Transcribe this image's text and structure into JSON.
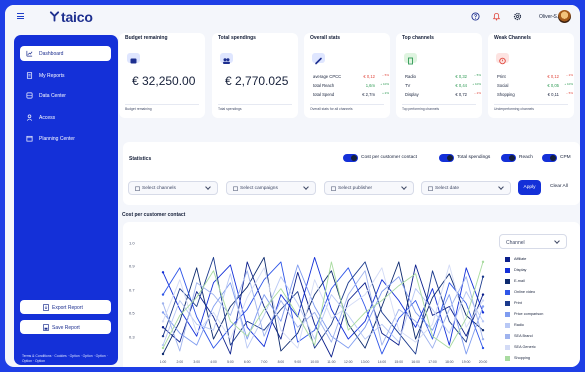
{
  "app": {
    "logo": "taico",
    "user_name": "Oliver S."
  },
  "sidebar": {
    "items": [
      {
        "label": "Dashboard",
        "icon": "dashboard-icon",
        "active": true
      },
      {
        "label": "My Reports",
        "icon": "reports-icon",
        "active": false
      },
      {
        "label": "Data Center",
        "icon": "data-center-icon",
        "active": false
      },
      {
        "label": "Access",
        "icon": "access-icon",
        "active": false
      },
      {
        "label": "Planning Center",
        "icon": "calendar-icon",
        "active": false
      }
    ],
    "export_label": "Export Report",
    "save_label": "Save Report",
    "footer": "Terms & Conditions · Cookies · Option · Option · Option · Option · Option"
  },
  "cards": {
    "budget": {
      "title": "Budget remaining",
      "value": "€ 32,250.00",
      "footer": "Budget remaining",
      "badge_color": "#dfe6ff"
    },
    "spendings": {
      "title": "Total spendings",
      "value": "€ 2,770.025",
      "footer": "Total spendings",
      "badge_color": "#dfe6ff"
    },
    "overall": {
      "title": "Overall stats",
      "footer": "Overall stats for all channels",
      "rows": [
        {
          "label": "average CPCC",
          "value": "€ 0,12",
          "change": "− 5%",
          "trend": "neg"
        },
        {
          "label": "total Reach",
          "value": "1,6m",
          "change": "+ 10%",
          "trend": "pos"
        },
        {
          "label": "total Spend",
          "value": "€ 2,7m",
          "change": "+ 2%",
          "trend": "pos"
        }
      ]
    },
    "top_channels": {
      "title": "Top channels",
      "footer": "Top performing channels",
      "rows": [
        {
          "label": "Radio",
          "value": "€ 0,32",
          "change": "− 5%",
          "trend": "pos"
        },
        {
          "label": "TV",
          "value": "€ 0,44",
          "change": "+ 10%",
          "trend": "pos"
        },
        {
          "label": "Display",
          "value": "€ 0,72",
          "change": "− 2%",
          "trend": "neutral"
        }
      ]
    },
    "weak_channels": {
      "title": "Weak Channels",
      "footer": "Underperforming channels",
      "rows": [
        {
          "label": "Print",
          "value": "€ 0,12",
          "change": "− 2%",
          "trend": "neg"
        },
        {
          "label": "Social",
          "value": "€ 0,05",
          "change": "+ 10%",
          "trend": "pos"
        },
        {
          "label": "Shopping",
          "value": "€ 0,11",
          "change": "− 5%",
          "trend": "neutral"
        }
      ]
    }
  },
  "statistics": {
    "title": "Statistics",
    "toggles": [
      {
        "label": "Cost per customer contact",
        "on": true
      },
      {
        "label": "Total spendings",
        "on": true
      },
      {
        "label": "Reach",
        "on": true
      },
      {
        "label": "CPM",
        "on": true
      }
    ],
    "filters": [
      {
        "placeholder": "Select channels",
        "icon": "calendar-icon"
      },
      {
        "placeholder": "Select campaigns",
        "icon": "calendar-icon"
      },
      {
        "placeholder": "Select publisher",
        "icon": "calendar-icon"
      },
      {
        "placeholder": "Select date",
        "icon": "calendar-icon"
      }
    ],
    "apply_label": "Apply",
    "clear_label": "Clear All"
  },
  "chart_section": {
    "title": "Cost per customer contact",
    "legend_select": "Channel"
  },
  "chart_data": {
    "type": "line",
    "title": "Cost per customer contact",
    "x": [
      "1:00",
      "2:00",
      "3:00",
      "4:00",
      "5:00",
      "6:00",
      "7:00",
      "8:00",
      "9:00",
      "10:00",
      "11:00",
      "12:00",
      "13:00",
      "14:00",
      "15:00",
      "16:00",
      "17:00",
      "18:00",
      "19:00",
      "20:00"
    ],
    "yticks": [
      1.0,
      0.9,
      0.7,
      0.5,
      0.3
    ],
    "series": [
      {
        "name": "Affiliate",
        "color": "#0b1f8c",
        "values": [
          0.48,
          0.38,
          0.72,
          0.55,
          0.3,
          0.92,
          0.62,
          0.4,
          0.85,
          0.5,
          0.28,
          0.66,
          0.78,
          0.44,
          0.36,
          0.9,
          0.56,
          0.62,
          0.42,
          0.7
        ]
      },
      {
        "name": "Display",
        "color": "#1430d8",
        "values": [
          0.85,
          0.6,
          0.42,
          0.78,
          0.9,
          0.48,
          0.35,
          0.7,
          0.55,
          0.95,
          0.6,
          0.4,
          0.52,
          0.8,
          0.66,
          0.48,
          0.74,
          0.36,
          0.88,
          0.58
        ]
      },
      {
        "name": "E-mail",
        "color": "#0d2a6e",
        "values": [
          0.3,
          0.52,
          0.88,
          0.4,
          0.62,
          0.75,
          0.95,
          0.32,
          0.44,
          0.7,
          0.86,
          0.5,
          0.34,
          0.62,
          0.92,
          0.4,
          0.68,
          0.84,
          0.56,
          0.46
        ]
      },
      {
        "name": "Online video",
        "color": "#2f56e8",
        "values": [
          0.7,
          0.88,
          0.55,
          0.34,
          0.48,
          0.6,
          0.8,
          0.92,
          0.38,
          0.46,
          0.74,
          0.88,
          0.62,
          0.3,
          0.54,
          0.66,
          0.4,
          0.78,
          0.64,
          0.34
        ]
      },
      {
        "name": "Print",
        "color": "#1b3a8c",
        "values": [
          0.42,
          0.74,
          0.62,
          0.95,
          0.36,
          0.52,
          0.46,
          0.6,
          0.72,
          0.34,
          0.5,
          0.78,
          0.92,
          0.58,
          0.44,
          0.3,
          0.86,
          0.52,
          0.38,
          0.82
        ]
      },
      {
        "name": "Price comparison",
        "color": "#7f9cf0",
        "values": [
          0.58,
          0.44,
          0.36,
          0.62,
          0.78,
          0.4,
          0.7,
          0.52,
          0.9,
          0.62,
          0.42,
          0.34,
          0.48,
          0.72,
          0.82,
          0.58,
          0.46,
          0.7,
          0.3,
          0.62
        ]
      },
      {
        "name": "Radio",
        "color": "#b8c8f5",
        "values": [
          0.36,
          0.66,
          0.5,
          0.46,
          0.84,
          0.34,
          0.56,
          0.82,
          0.64,
          0.4,
          0.7,
          0.56,
          0.4,
          0.5,
          0.38,
          0.74,
          0.6,
          0.44,
          0.72,
          0.52
        ]
      },
      {
        "name": "SEA Brand",
        "color": "#9fb3ee",
        "values": [
          0.64,
          0.32,
          0.78,
          0.7,
          0.56,
          0.86,
          0.42,
          0.66,
          0.48,
          0.58,
          0.38,
          0.7,
          0.86,
          0.36,
          0.6,
          0.52,
          0.34,
          0.6,
          0.82,
          0.4
        ]
      },
      {
        "name": "SEA Generic",
        "color": "#d3dbf6",
        "values": [
          0.52,
          0.8,
          0.44,
          0.58,
          0.4,
          0.68,
          0.88,
          0.46,
          0.34,
          0.8,
          0.54,
          0.62,
          0.7,
          0.88,
          0.46,
          0.38,
          0.5,
          0.9,
          0.48,
          0.66
        ]
      },
      {
        "name": "Shopping",
        "color": "#a9dba0",
        "values": [
          0.34,
          0.56,
          0.68,
          0.86,
          0.52,
          0.42,
          0.6,
          0.74,
          0.56,
          0.36,
          0.92,
          0.46,
          0.58,
          0.66,
          0.76,
          0.84,
          0.42,
          0.34,
          0.54,
          0.92
        ]
      }
    ]
  }
}
